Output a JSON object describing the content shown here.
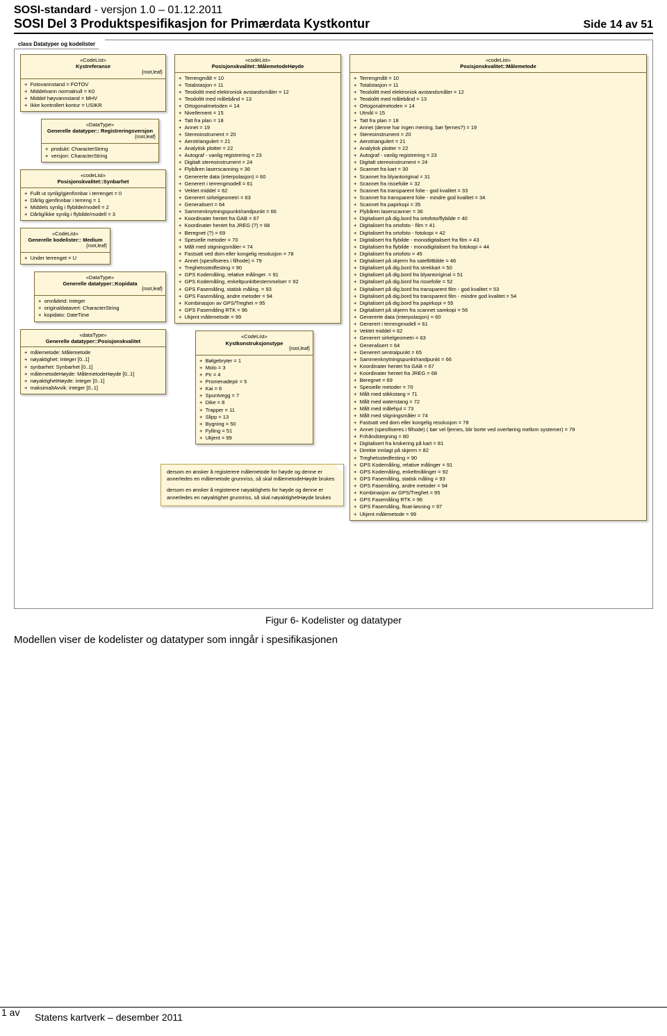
{
  "header": {
    "std": "SOSI-standard",
    "version": " - versjon 1.0 – 01.12.2011",
    "main": "SOSI Del 3 Produktspesifikasjon for Primærdata Kystkontur",
    "side": "Side 14 av 51"
  },
  "diagram": {
    "title": "class Datatyper og kodelister"
  },
  "kystref": {
    "stereo": "«CodeList»",
    "name": "Kystreferanse",
    "root": "{root,leaf}",
    "items": [
      "Fotovannstand = FOTOV",
      "Middelvann normalnull = K0",
      "Middel høyvannstand = MHV",
      "Ikke kontrollert kontur = USIKR"
    ]
  },
  "regver": {
    "stereo": "«DataType»",
    "name": "Generelle datatyper:: Registreringsversjon",
    "root": "{root,leaf}",
    "items": [
      "produkt:  CharacterString",
      "versjon:  CharacterString"
    ]
  },
  "synbar": {
    "stereo": "«codeList»",
    "name": "Posisjonskvalitet::Synbarhet",
    "items": [
      "Fullt ut synlig/gjenfinnbar i terrenget = 0",
      "Dårlig gjenfinnbar i terreng = 1",
      "Middels synlig i flybilde/modell = 2",
      "Dårlig/ikke synlig i flybilde/modell = 3"
    ]
  },
  "medium": {
    "stereo": "«CodeList»",
    "name": "Generelle kodelister:: Medium",
    "root": "{root,leaf}",
    "items": [
      "Under terrenget = U"
    ]
  },
  "kopi": {
    "stereo": "«DataType»",
    "name": "Generelle datatyper::Kopidata",
    "root": "{root,leaf}",
    "items": [
      "områdeId:  Integer",
      "originaldatavert:  CharacterString",
      "kopidato:  DateTime"
    ]
  },
  "poskval": {
    "stereo": "«dataType»",
    "name": "Generelle datatyper::Posisjonskvalitet",
    "items": [
      "målemetode:  Målemetode",
      "nøyaktighet:  Integer [0..1]",
      "synbarhet:  Synbarhet [0..1]",
      "målemetodeHøyde:  MålemetodeHøyde [0..1]",
      "nøyaktighetHøyde:  integer [0..1]",
      "maksimaltAvvik:  integer [0..1]"
    ]
  },
  "malH": {
    "stereo": "«codeList»",
    "name": "Posisjonskvalitet::MålemetodeHøyde",
    "items": [
      "Terrengmålt = 10",
      "Totalstasjon = 11",
      "Teodolitt med elektronisk avstandsmåler = 12",
      "Teodolitt med målebånd = 13",
      "Ortogonalmetoden = 14",
      "Nivellement = 15",
      "Tatt fra plan = 18",
      "Annet = 19",
      "Stereoinstrument = 20",
      "Aerotriangulert = 21",
      "Analytisk plotter = 22",
      "Autograf - vanlig registrering = 23",
      "Digitalt stereoinstrument = 24",
      "Flybåren laserscanning = 36",
      "Genererte data (interpolasjon) = 60",
      "Generert i terrengmodell = 61",
      "Vektet middel = 62",
      "Generert sirkelgeometri = 63",
      "Generalisert = 64",
      "Sammenknytningspunkt/randpunkt = 66",
      "Koordinater hentet fra GAB = 67",
      "Koordinater hentet fra JREG (?) = 68",
      "Beregnet (?) = 69",
      "Spesielle metoder = 70",
      "Målt med stigningsmåler = 74",
      "Fastsatt ved dom eller kongelig resolusjon = 78",
      "Annet (spesifiseres i filhode) = 79",
      "Treghetsstedfesting = 90",
      "GPS Kodemåling, relative målinger. = 91",
      "GPS Kodemåling, enkeltpunktbestemmelser = 92",
      "GPS Fasemåling, statisk måling. = 93",
      "GPS Fasemåling, andre metoder = 94",
      "Kombinasjon av GPS/Treghet = 95",
      "GPS Fasemåling RTK = 96",
      "Ukjent målemetode = 99"
    ]
  },
  "kystkon": {
    "stereo": "«CodeList»",
    "name": "Kystkonstruksjonstype",
    "root": "{root,leaf}",
    "items": [
      "Bølgebryter = 1",
      "Molo = 3",
      "Pir = 4",
      "Promenadepir = 5",
      "Kai = 6",
      "Spuntvegg = 7",
      "Dike = 8",
      "Trapper = 11",
      "Slipp = 13",
      "Bygning = 50",
      "Fylling = 51",
      "Ukjent = 99"
    ]
  },
  "mal": {
    "stereo": "«codeList»",
    "name": "Posisjonskvalitet::Målemetode",
    "items": [
      "Terrengmålt = 10",
      "Totalstasjon = 11",
      "Teodolitt med elektronisk avstandsmåler = 12",
      "Teodolitt med målebånd = 13",
      "Ortogonalmetoden = 14",
      "Utmål = 15",
      "Tatt fra plan = 18",
      "Annet  (denne har ingen mening, bør fjernes?) = 19",
      "Stereoinstrument = 20",
      "Aerotriangulert = 21",
      "Analytisk plotter = 22",
      "Autograf - vanlig registrering = 23",
      "Digitalt stereoinstrument = 24",
      "Scannet fra kart = 30",
      "Scannet fra blyantoriginal = 31",
      "Scannet fra rissefolie = 32",
      "Scannet fra transparent folie - god kvalitet = 33",
      "Scannet fra transparent folie - mindre god kvalitet = 34",
      "Scannet fra papirkopi = 35",
      "Flybåren laserscanner = 36",
      "Digitalisert på dig.bord fra ortofoto/flybilde = 40",
      "Digitalisert fra ortofoto - film = 41",
      "Digitalisert fra ortofoto - fotokopi = 42",
      "Digitalisert fra flybilde - monodigitalisert fra film = 43",
      "Digitalisert fra flybilde - monodigitalisert fra fotokopi = 44",
      "Digitalisert fra ortofoto = 45",
      "Digitalisert på skjerm fra satellittbilde = 46",
      "Digitalisert på dig.bord fra strekkart = 50",
      "Digitalisert på dig.bord fra blyantoriginal = 51",
      "Digitalisert på dig.bord fra rissefolie = 52",
      "Digitalisert på dig.bord fra transparent film - god kvalitet = 53",
      "Digitalisert på dig.bord fra transparent film - mindre god kvalitet = 54",
      "Digitalisert på dig.bord fra papirkopi = 55",
      "Digitalisert på skjerm fra scannet samkopi = 56",
      "Genererte data (interpolasjon) = 60",
      "Generert i terrengmodell = 61",
      "Vektet middel = 62",
      "Generert sirkelgeometri = 63",
      "Generalisert = 64",
      "Generert sentralpunkt = 65",
      "Sammenknytningspunkt/randpunkt = 66",
      "Koordinater hentet fra GAB = 67",
      "Koordinater hentet fra JREG = 68",
      "Beregnet = 69",
      "Spesielle metoder = 70",
      "Målt med stikkstang = 71",
      "Målt med waterstang = 72",
      "Målt med målehjul = 73",
      "Målt med stigningsmåler = 74",
      "Fastsatt ved dom eller kongelig resolusjon = 78",
      "Annet (spesifiseres i filhode) ( bør vel fjernes, blir borte ved overføring mellom systemer) = 79",
      "Frihåndstegning = 80",
      "Digitalisert fra krokering på kart = 81",
      "Direkte innlagt på skjerm = 82",
      "Treghetsstedfesting = 90",
      "GPS Kodemåling, relative målinger = 91",
      "GPS Kodemåling, enkeltmålinger = 92",
      "GPS Fasemåling, statisk måling = 93",
      "GPS Fasemåling, andre metoder = 94",
      "Kombinasjon av GPS/Treghet = 95",
      "GPS Fasemåling RTK = 96",
      "GPS Fasemåling, float-løsning = 97",
      "Ukjent målemetode = 99"
    ]
  },
  "note": {
    "p1": "dersom en ønsker å registerere målemetode for høyde og denne er annerledes en målemetode grunnriss, så skal målemetodeHøyde brukes",
    "p2": "dersom en ønsker å registerere nøyaktighets for høyde og denne er annerledes en nøyaktighet grunnriss, så skal nøyaktighetHøyde brukes"
  },
  "caption": "Figur 6- Kodelister og datatyper",
  "body": "Modellen viser de kodelister og datatyper som inngår i spesifikasjonen",
  "footer": {
    "left": "1 av",
    "main": "Statens kartverk – desember 2011"
  }
}
